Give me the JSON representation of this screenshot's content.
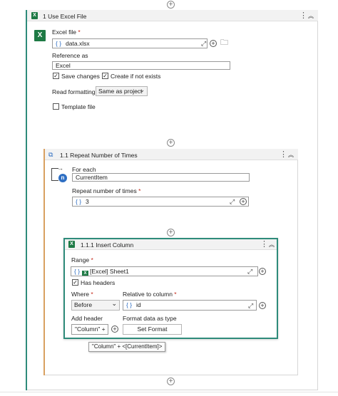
{
  "outer": {
    "title": "1 Use Excel File",
    "badge": "X",
    "excel_file_label": "Excel file",
    "excel_file_value": "data.xlsx",
    "reference_label": "Reference as",
    "reference_value": "Excel",
    "save_changes_label": "Save changes",
    "create_if_not_exists_label": "Create if not exists",
    "read_formatting_label": "Read formatting",
    "read_formatting_value": "Same as project",
    "template_file_label": "Template file"
  },
  "repeat": {
    "title": "1.1 Repeat Number of Times",
    "badge_n": "n",
    "for_each_label": "For each",
    "for_each_value": "CurrentItem",
    "repeat_label": "Repeat number of times",
    "repeat_value": "3"
  },
  "insert": {
    "title": "1.1.1 Insert Column",
    "badge": "X",
    "range_label": "Range",
    "range_value": "[Excel] Sheet1",
    "has_headers_label": "Has headers",
    "where_label": "Where",
    "where_value": "Before",
    "relative_label": "Relative to column",
    "relative_value": "id",
    "add_header_label": "Add header",
    "add_header_value": "\"Column\" +",
    "format_label": "Format data as type",
    "format_button": "Set Format",
    "tooltip": "\"Column\" + <[CurrentItem]>"
  },
  "common": {
    "required_mark": "*",
    "brace": "{ }",
    "plus": "+",
    "kebab": "⋮",
    "collapse": "︽",
    "check": "✓",
    "chevron_down": "⌄"
  },
  "colors": {
    "excel_green": "#1e7a45",
    "teal_border": "#2e8b7a",
    "orange_line": "#d9a060",
    "blue_accent": "#2f6fc3"
  }
}
